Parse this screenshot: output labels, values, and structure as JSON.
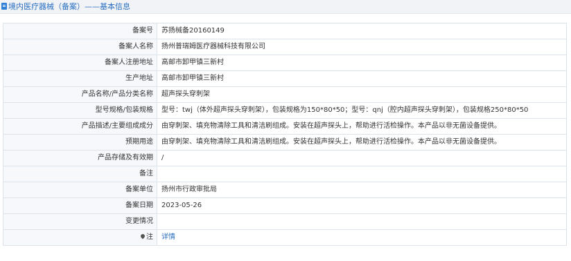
{
  "header": {
    "title": "境内医疗器械（备案）——基本信息"
  },
  "rows": [
    {
      "label": "备案号",
      "value": "苏扬械备20160149"
    },
    {
      "label": "备案人名称",
      "value": "扬州普瑞姆医疗器械科技有限公司"
    },
    {
      "label": "备案人注册地址",
      "value": "高邮市卸甲镇三新村"
    },
    {
      "label": "生产地址",
      "value": "高邮市卸甲镇三新村"
    },
    {
      "label": "产品名称/产品分类名称",
      "value": "超声探头穿刺架"
    },
    {
      "label": "型号规格/包装规格",
      "value": "型号：twj（体外超声探头穿刺架），包装规格为150*80*50；型号：qnj（腔内超声探头穿刺架），包装规格250*80*50"
    },
    {
      "label": "产品描述/主要组成成分",
      "value": "由穿刺架、填充物清除工具和清洁刷组成。安装在超声探头上，帮助进行活检操作。本产品以非无菌设备提供。"
    },
    {
      "label": "预期用途",
      "value": "由穿刺架、填充物清除工具和清洁刷组成。安装在超声探头上，帮助进行活检操作。本产品以非无菌设备提供。"
    },
    {
      "label": "产品存储及有效期",
      "value": "/"
    },
    {
      "label": "备注",
      "value": ""
    },
    {
      "label": "备案单位",
      "value": "扬州市行政审批局"
    },
    {
      "label": "备案日期",
      "value": "2023-05-26"
    },
    {
      "label": "变更情况",
      "value": ""
    }
  ],
  "note_row": {
    "label": "注",
    "link_text": "详情"
  }
}
